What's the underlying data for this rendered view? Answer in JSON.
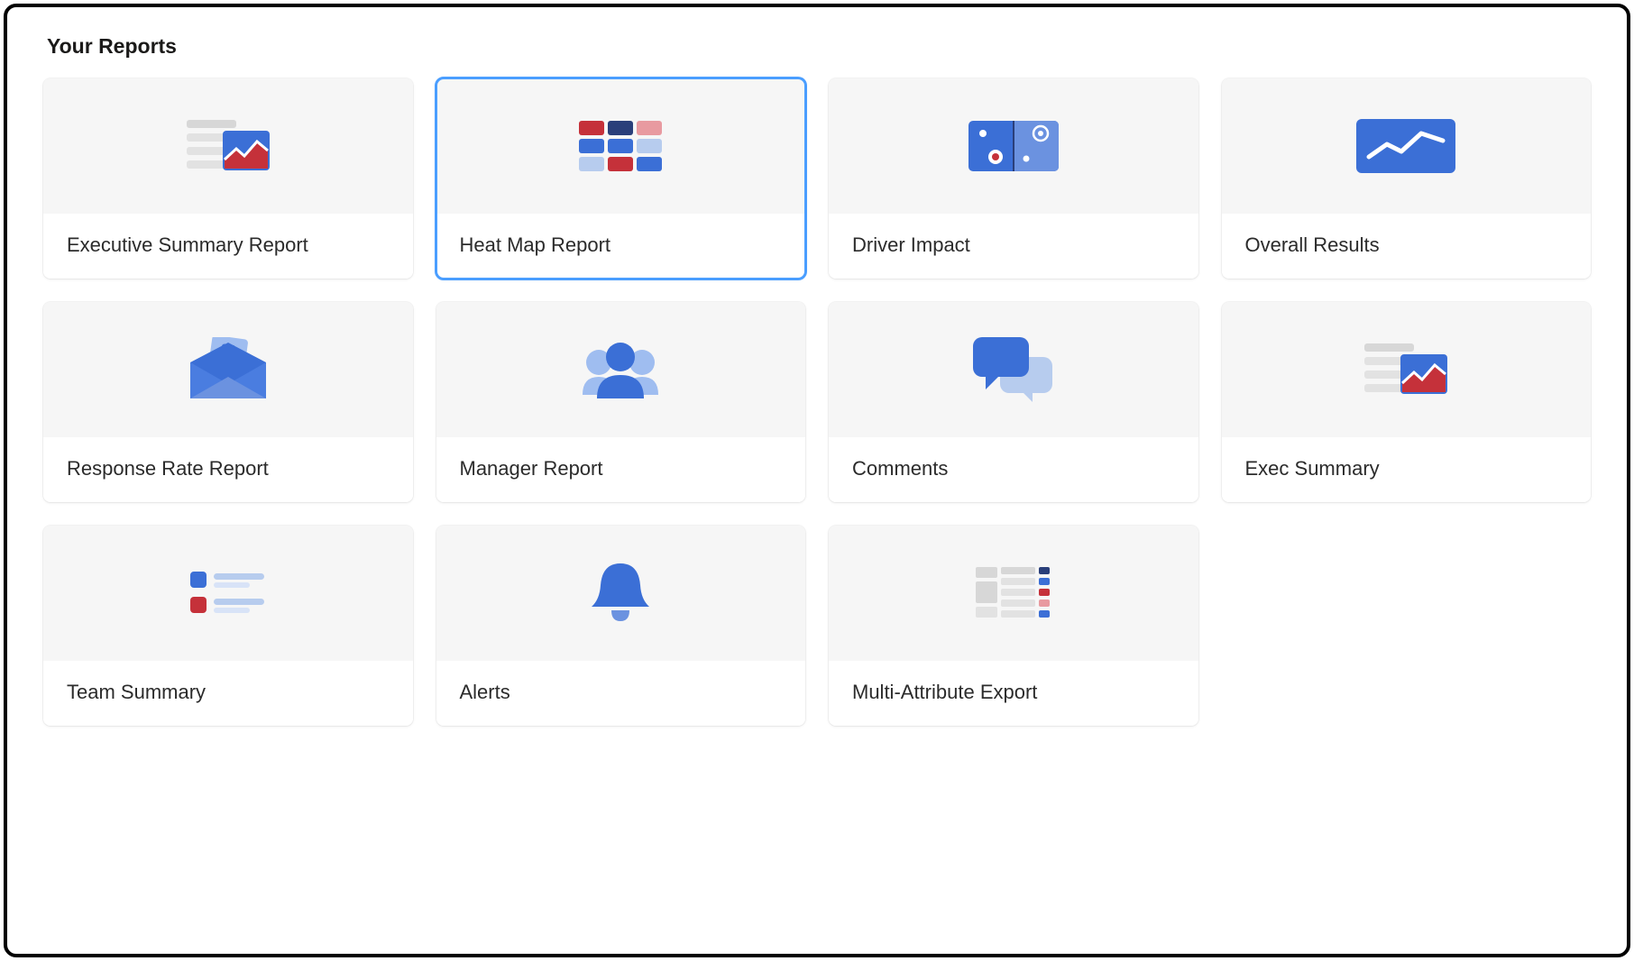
{
  "section_title": "Your Reports",
  "cards": [
    {
      "title": "Executive Summary Report",
      "icon": "exec-summary-icon",
      "selected": false
    },
    {
      "title": "Heat Map Report",
      "icon": "heat-map-icon",
      "selected": true
    },
    {
      "title": "Driver Impact",
      "icon": "driver-impact-icon",
      "selected": false
    },
    {
      "title": "Overall Results",
      "icon": "overall-results-icon",
      "selected": false
    },
    {
      "title": "Response Rate Report",
      "icon": "response-rate-icon",
      "selected": false
    },
    {
      "title": "Manager Report",
      "icon": "manager-report-icon",
      "selected": false
    },
    {
      "title": "Comments",
      "icon": "comments-icon",
      "selected": false
    },
    {
      "title": "Exec Summary",
      "icon": "exec-summary-icon",
      "selected": false
    },
    {
      "title": "Team Summary",
      "icon": "team-summary-icon",
      "selected": false
    },
    {
      "title": "Alerts",
      "icon": "alerts-icon",
      "selected": false
    },
    {
      "title": "Multi-Attribute Export",
      "icon": "multi-attribute-icon",
      "selected": false
    }
  ]
}
